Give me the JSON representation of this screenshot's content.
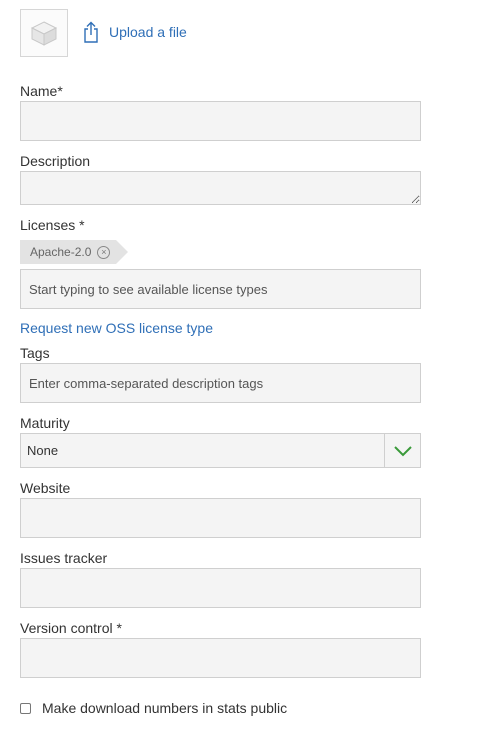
{
  "upload": {
    "label": "Upload a file",
    "thumbnail_icon": "package-placeholder-icon",
    "upload_icon": "upload-icon"
  },
  "fields": {
    "name": {
      "label": "Name*",
      "value": "",
      "placeholder": ""
    },
    "description": {
      "label": "Description",
      "value": "",
      "placeholder": ""
    },
    "licenses": {
      "label": "Licenses *",
      "selected_tag": "Apache-2.0",
      "placeholder": "Start typing to see available license types"
    },
    "request_license_link": "Request new OSS license type",
    "tags": {
      "label": "Tags",
      "placeholder": "Enter comma-separated description tags"
    },
    "maturity": {
      "label": "Maturity",
      "selected": "None"
    },
    "website": {
      "label": "Website",
      "value": ""
    },
    "issues_tracker": {
      "label": "Issues tracker",
      "value": ""
    },
    "version_control": {
      "label": "Version control *",
      "value": ""
    }
  },
  "stats_public": {
    "label": "Make download numbers in stats public",
    "checked": false
  },
  "colors": {
    "link": "#2f6fb7",
    "field_bg": "#f4f4f4",
    "field_border": "#cfcfcf",
    "dropdown_chevron": "#3a9a3a",
    "chip_bg": "#e3e3e3"
  }
}
